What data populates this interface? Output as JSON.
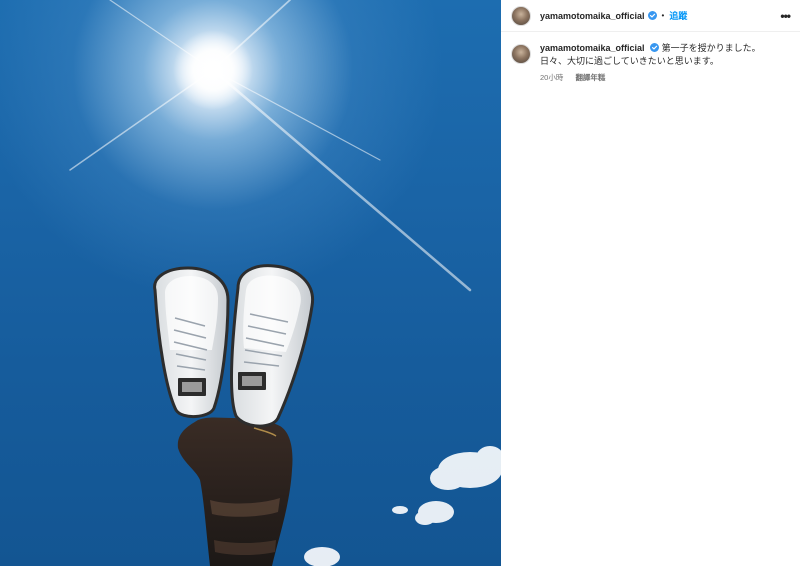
{
  "post": {
    "username": "yamamotomaika_official",
    "follow_label": "追蹤",
    "more_icon": "•••",
    "caption_line1": "第一子を授かりました。",
    "caption_line2": "日々、大切に過ごしていきたいと思います。",
    "time_ago": "20小時",
    "translate_label": "翻譯年糕"
  },
  "colors": {
    "sky": "#1a64a6",
    "link_blue": "#0095f6",
    "verified_blue": "#3897f0",
    "meta_gray": "#737373"
  },
  "icons": [
    "verified-badge-icon",
    "more-options-icon"
  ]
}
